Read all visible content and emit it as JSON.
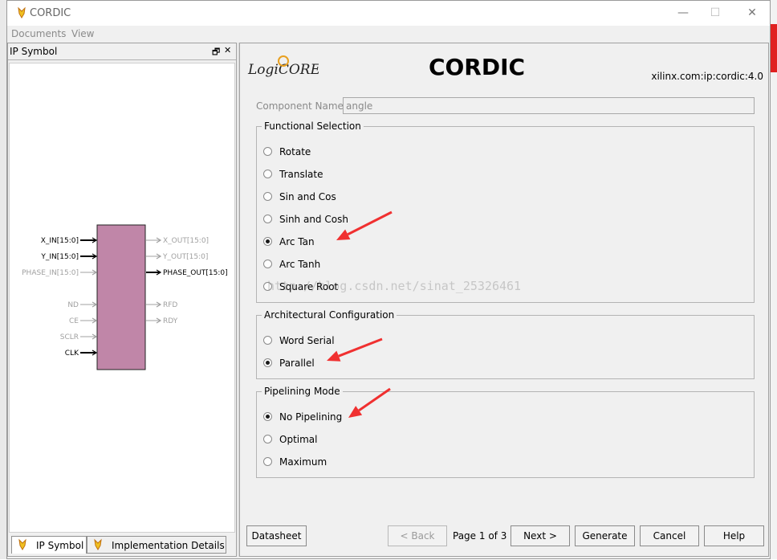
{
  "window": {
    "title": "CORDIC",
    "controls": [
      "—",
      "☐",
      "✕"
    ]
  },
  "menu": {
    "items": [
      "Documents",
      "View"
    ]
  },
  "left_panel": {
    "title": "IP Symbol",
    "tabs": [
      {
        "label": "IP Symbol",
        "active": true
      },
      {
        "label": "Implementation Details",
        "active": false
      }
    ],
    "symbol": {
      "inputs": [
        {
          "label": "X_IN[15:0]",
          "active": true
        },
        {
          "label": "Y_IN[15:0]",
          "active": true
        },
        {
          "label": "PHASE_IN[15:0]",
          "active": false
        },
        {
          "label": "ND",
          "active": false
        },
        {
          "label": "CE",
          "active": false
        },
        {
          "label": "SCLR",
          "active": false
        },
        {
          "label": "CLK",
          "active": true
        }
      ],
      "outputs": [
        {
          "label": "X_OUT[15:0]",
          "active": false
        },
        {
          "label": "Y_OUT[15:0]",
          "active": false
        },
        {
          "label": "PHASE_OUT[15:0]",
          "active": true
        },
        {
          "label": "RFD",
          "active": false
        },
        {
          "label": "RDY",
          "active": false
        }
      ],
      "block_color": "#c086a8"
    }
  },
  "right_panel": {
    "logo_text": "LogiCORE",
    "title": "CORDIC",
    "vlnv": "xilinx.com:ip:cordic:4.0",
    "component_name_label": "Component Name",
    "component_name_value": "angle",
    "functional_selection": {
      "legend": "Functional Selection",
      "options": [
        "Rotate",
        "Translate",
        "Sin and Cos",
        "Sinh and Cosh",
        "Arc Tan",
        "Arc Tanh",
        "Square Root"
      ],
      "selected": "Arc Tan"
    },
    "architectural_configuration": {
      "legend": "Architectural Configuration",
      "options": [
        "Word Serial",
        "Parallel"
      ],
      "selected": "Parallel"
    },
    "pipelining_mode": {
      "legend": "Pipelining Mode",
      "options": [
        "No Pipelining",
        "Optimal",
        "Maximum"
      ],
      "selected": "No Pipelining"
    },
    "buttons": {
      "datasheet": "Datasheet",
      "back": "< Back",
      "page_indicator": "Page 1 of 3",
      "next": "Next >",
      "generate": "Generate",
      "cancel": "Cancel",
      "help": "Help"
    }
  },
  "watermark": "http://blog.csdn.net/sinat_25326461",
  "annotation_color": "#f03030"
}
